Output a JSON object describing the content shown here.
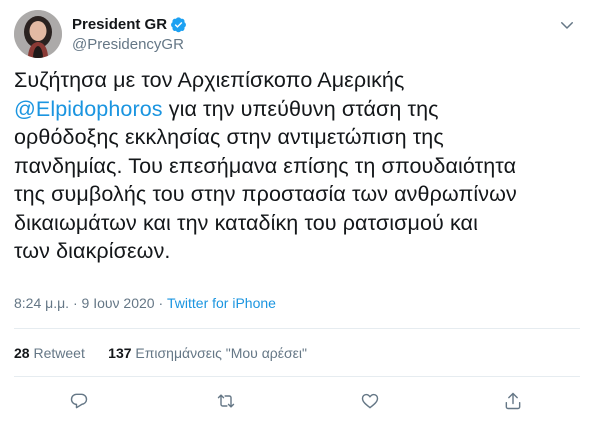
{
  "tweet": {
    "display_name": "President GR",
    "handle": "@PresidencyGR",
    "text_lines": [
      "Συζήτησα με τον Αρχιεπίσκοπο Αμερικής",
      [
        "@Elpidophoros",
        " για την υπεύθυνη στάση της"
      ],
      "ορθόδοξης εκκλησίας στην αντιμετώπιση της",
      "πανδημίας. Του επεσήμανα επίσης τη σπουδαιότητα",
      "της συμβολής του στην προστασία των ανθρωπίνων",
      "δικαιωμάτων και την καταδίκη του ρατσισμού και",
      "των διακρίσεων."
    ],
    "mention": "@Elpidophoros",
    "line2_rest": " για την υπεύθυνη στάση της",
    "time": "8:24 μ.μ.",
    "date_sep": " · ",
    "date": "9 Ιουν 2020",
    "source": "Twitter for iPhone",
    "retweet_count": "28",
    "retweet_label": "Retweet",
    "like_count": "137",
    "like_label": "Επισημάνσεις \"Μου αρέσει\""
  },
  "icons": {
    "verified": "verified-badge-icon",
    "more": "chevron-down-icon",
    "reply": "reply-icon",
    "retweet": "retweet-icon",
    "like": "heart-icon",
    "share": "share-icon"
  },
  "colors": {
    "accent": "#1b95e0",
    "text": "#14171a",
    "muted": "#657786",
    "divider": "#e6ecf0"
  }
}
